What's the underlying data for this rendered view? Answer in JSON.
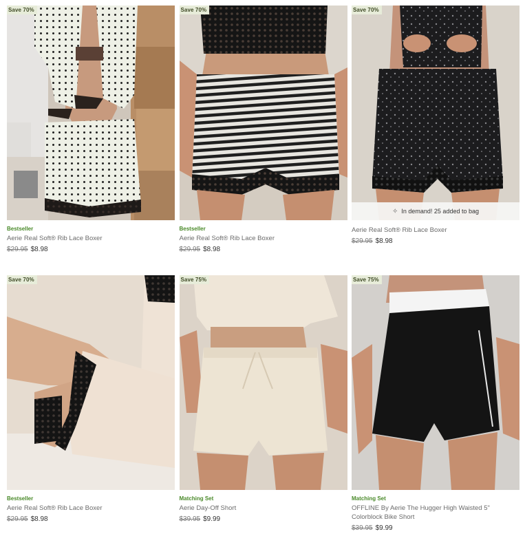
{
  "products": [
    {
      "badge": "Save 70%",
      "tag": "Bestseller",
      "name": "Aerie Real Soft® Rib Lace Boxer",
      "price_old": "$29.95",
      "price_new": "$8.98",
      "image": "polka-dot-boxer-photo"
    },
    {
      "badge": "Save 70%",
      "tag": "Bestseller",
      "name": "Aerie Real Soft® Rib Lace Boxer",
      "price_old": "$29.95",
      "price_new": "$8.98",
      "image": "striped-boxer-photo"
    },
    {
      "badge": "Save 70%",
      "tag": "",
      "name": "Aerie Real Soft® Rib Lace Boxer",
      "price_old": "$29.95",
      "price_new": "$8.98",
      "image": "black-floral-boxer-photo",
      "demand": "In demand! 25 added to bag"
    },
    {
      "badge": "Save 70%",
      "tag": "Bestseller",
      "name": "Aerie Real Soft® Rib Lace Boxer",
      "price_old": "$29.95",
      "price_new": "$8.98",
      "image": "cream-lace-boxer-photo"
    },
    {
      "badge": "Save 75%",
      "tag": "Matching Set",
      "name": "Aerie Day-Off Short",
      "price_old": "$39.95",
      "price_new": "$9.99",
      "image": "linen-short-photo"
    },
    {
      "badge": "Save 75%",
      "tag": "Matching Set",
      "name": "OFFLINE By Aerie The Hugger High Waisted 5\" Colorblock Bike Short",
      "price_old": "$39.95",
      "price_new": "$9.99",
      "image": "bike-short-photo"
    }
  ],
  "colors": {
    "badge_bg": "#e7ecd9",
    "tag_green": "#4a8a2a",
    "lace_black": "#1a1a1a"
  }
}
